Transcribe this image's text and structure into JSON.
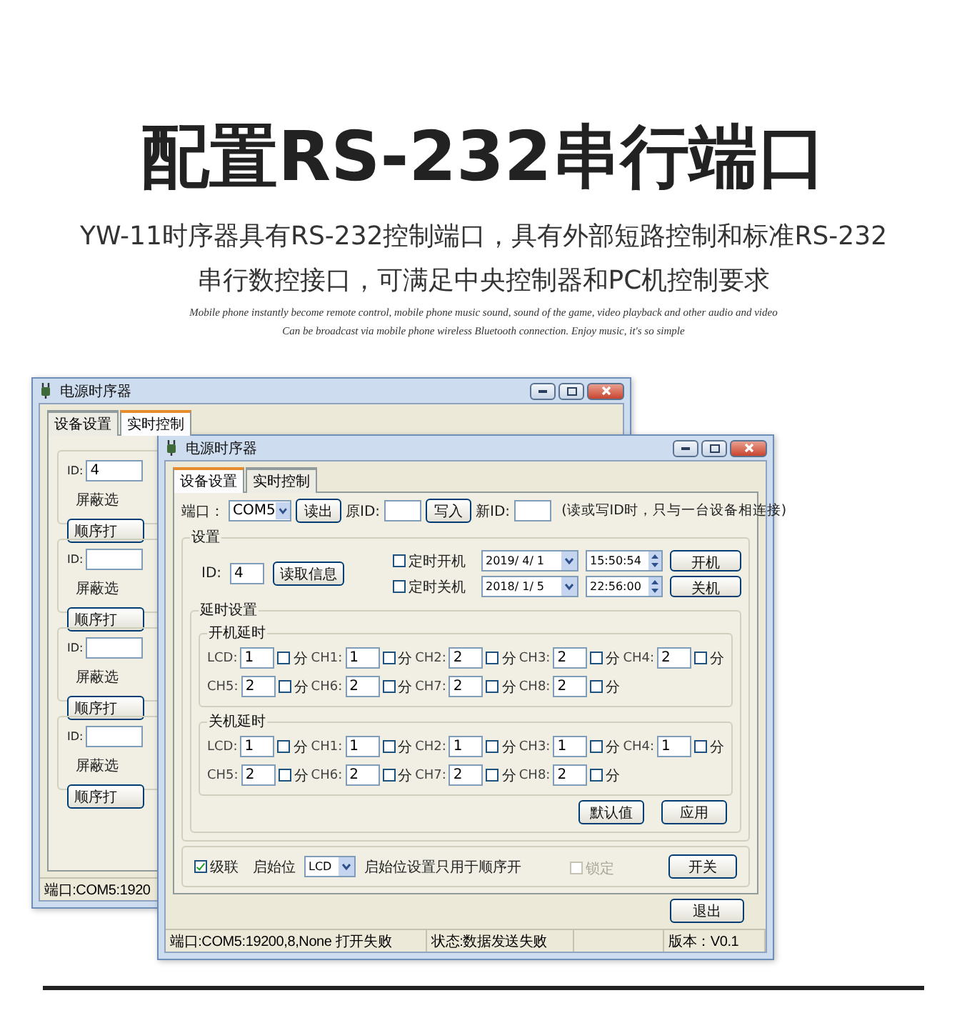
{
  "header": {
    "title": "配置RS-232串行端口",
    "subtitle_lines": [
      "YW-11时序器具有RS-232控制端口，具有外部短路控制和标准RS-232",
      "串行数控接口，可满足中央控制器和PC机控制要求"
    ],
    "tagline_lines": [
      "Mobile phone instantly become remote control, mobile phone music sound, sound of the game, video playback and other audio and video",
      "Can be broadcast via mobile phone wireless Bluetooth connection. Enjoy music, it's so simple"
    ]
  },
  "back_window": {
    "title": "电源时序器",
    "tabs": [
      {
        "label": "设备设置",
        "selected": false
      },
      {
        "label": "实时控制",
        "selected": true
      }
    ],
    "groups": [
      {
        "id_label": "ID:",
        "id_value": "4",
        "mask_label": "屏蔽选",
        "button": "顺序打"
      },
      {
        "id_label": "ID:",
        "mask_label": "屏蔽选",
        "button": "顺序打"
      },
      {
        "id_label": "ID:",
        "mask_label": "屏蔽选",
        "button": "顺序打"
      },
      {
        "id_label": "ID:",
        "mask_label": "屏蔽选",
        "button": "顺序打"
      }
    ],
    "status": "端口:COM5:1920"
  },
  "front_window": {
    "title": "电源时序器",
    "tabs": [
      {
        "label": "设备设置",
        "selected": true
      },
      {
        "label": "实时控制",
        "selected": false
      }
    ],
    "port_row": {
      "port_label": "端口：",
      "port_value": "COM5",
      "read_button": "读出",
      "old_id_label": "原ID:",
      "write_button": "写入",
      "new_id_label": "新ID:",
      "hint": "(读或写ID时，只与一台设备相连接)"
    },
    "settings": {
      "legend": "设置",
      "id_label": "ID:",
      "id_value": "4",
      "read_info_button": "读取信息",
      "timers": [
        {
          "label": "定时开机",
          "checked": false,
          "date": "2019/ 4/ 1",
          "time": "15:50:54",
          "button": "开机"
        },
        {
          "label": "定时关机",
          "checked": false,
          "date": "2018/ 1/ 5",
          "time": "22:56:00",
          "button": "关机"
        }
      ]
    },
    "delay": {
      "legend": "延时设置",
      "groups": [
        {
          "legend": "开机延时",
          "channels": [
            {
              "label": "LCD:",
              "value": "1",
              "unit": "分",
              "checked": false
            },
            {
              "label": "CH1:",
              "value": "1",
              "unit": "分",
              "checked": false
            },
            {
              "label": "CH2:",
              "value": "2",
              "unit": "分",
              "checked": false
            },
            {
              "label": "CH3:",
              "value": "2",
              "unit": "分",
              "checked": false
            },
            {
              "label": "CH4:",
              "value": "2",
              "unit": "分",
              "checked": false
            },
            {
              "label": "CH5:",
              "value": "2",
              "unit": "分",
              "checked": false
            },
            {
              "label": "CH6:",
              "value": "2",
              "unit": "分",
              "checked": false
            },
            {
              "label": "CH7:",
              "value": "2",
              "unit": "分",
              "checked": false
            },
            {
              "label": "CH8:",
              "value": "2",
              "unit": "分",
              "checked": false
            }
          ]
        },
        {
          "legend": "关机延时",
          "channels": [
            {
              "label": "LCD:",
              "value": "1",
              "unit": "分",
              "checked": false
            },
            {
              "label": "CH1:",
              "value": "1",
              "unit": "分",
              "checked": false
            },
            {
              "label": "CH2:",
              "value": "1",
              "unit": "分",
              "checked": false
            },
            {
              "label": "CH3:",
              "value": "1",
              "unit": "分",
              "checked": false
            },
            {
              "label": "CH4:",
              "value": "1",
              "unit": "分",
              "checked": false
            },
            {
              "label": "CH5:",
              "value": "2",
              "unit": "分",
              "checked": false
            },
            {
              "label": "CH6:",
              "value": "2",
              "unit": "分",
              "checked": false
            },
            {
              "label": "CH7:",
              "value": "2",
              "unit": "分",
              "checked": false
            },
            {
              "label": "CH8:",
              "value": "2",
              "unit": "分",
              "checked": false
            }
          ]
        }
      ],
      "buttons": [
        "默认值",
        "应用"
      ]
    },
    "cascade": {
      "cascade_checkbox": {
        "label": "级联",
        "checked": true
      },
      "start_label": "启始位",
      "start_value": "LCD",
      "note": "启始位设置只用于顺序开",
      "lock": {
        "label": "锁定",
        "checked": false,
        "disabled": true
      },
      "button": "开关"
    },
    "exit_button": "退出",
    "status_bar": {
      "port": "端口:COM5:19200,8,None 打开失败",
      "state": "状态:数据发送失败",
      "version": "版本：V0.1"
    }
  }
}
